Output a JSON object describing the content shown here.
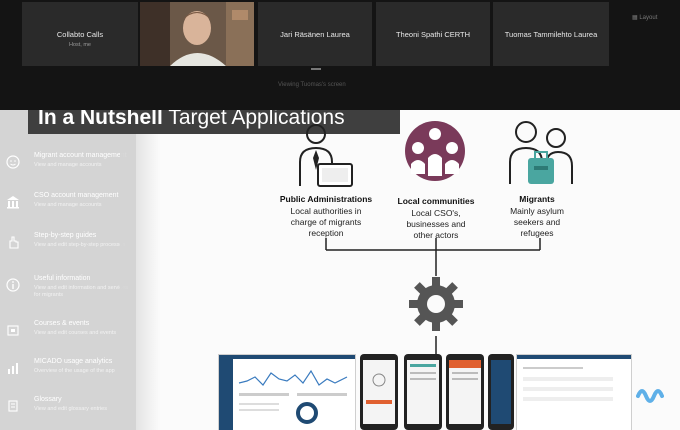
{
  "call": {
    "participants": [
      {
        "name": "Collabto Calls",
        "subtitle": "Host, me"
      },
      {
        "name": "",
        "subtitle": ""
      },
      {
        "name": "Jari Räsänen Laurea",
        "subtitle": ""
      },
      {
        "name": "Theoni Spathi CERTH",
        "subtitle": ""
      },
      {
        "name": "Tuomas Tammilehto Laurea",
        "subtitle": ""
      }
    ],
    "sharing_label": "Viewing Tuomas's screen",
    "corner_controls": "Layout"
  },
  "slide": {
    "title_bold": "In a Nutshell",
    "title_rest": " Target Applications",
    "sidebar": [
      {
        "icon": "face-icon",
        "title": "Migrant account management",
        "desc": "View and manage accounts"
      },
      {
        "icon": "building-icon",
        "title": "CSO account management",
        "desc": "View and manage accounts"
      },
      {
        "icon": "hand-icon",
        "title": "Step-by-step guides",
        "desc": "View and edit step-by-step processes"
      },
      {
        "icon": "info-icon",
        "title": "Useful information",
        "desc": "View and edit information and services for migrants"
      },
      {
        "icon": "calendar-icon",
        "title": "Courses & events",
        "desc": "View and edit courses and events"
      },
      {
        "icon": "chart-icon",
        "title": "MICADO usage analytics",
        "desc": "Overview of the usage of the app"
      },
      {
        "icon": "book-icon",
        "title": "Glossary",
        "desc": "View and edit glossary entries"
      }
    ],
    "groups": [
      {
        "title": "Public Administrations",
        "lines": [
          "Local authorities in",
          "charge of migrants",
          "reception"
        ]
      },
      {
        "title": "Local communities",
        "lines": [
          "Local CSO's,",
          "businesses and",
          "other actors"
        ]
      },
      {
        "title": "Migrants",
        "lines": [
          "Mainly asylum",
          "seekers and",
          "refugees"
        ]
      }
    ],
    "colors": {
      "accent": "#7a3a5a",
      "navy": "#1f4a73",
      "teal": "#4aa6a0",
      "orange": "#e06030"
    }
  }
}
